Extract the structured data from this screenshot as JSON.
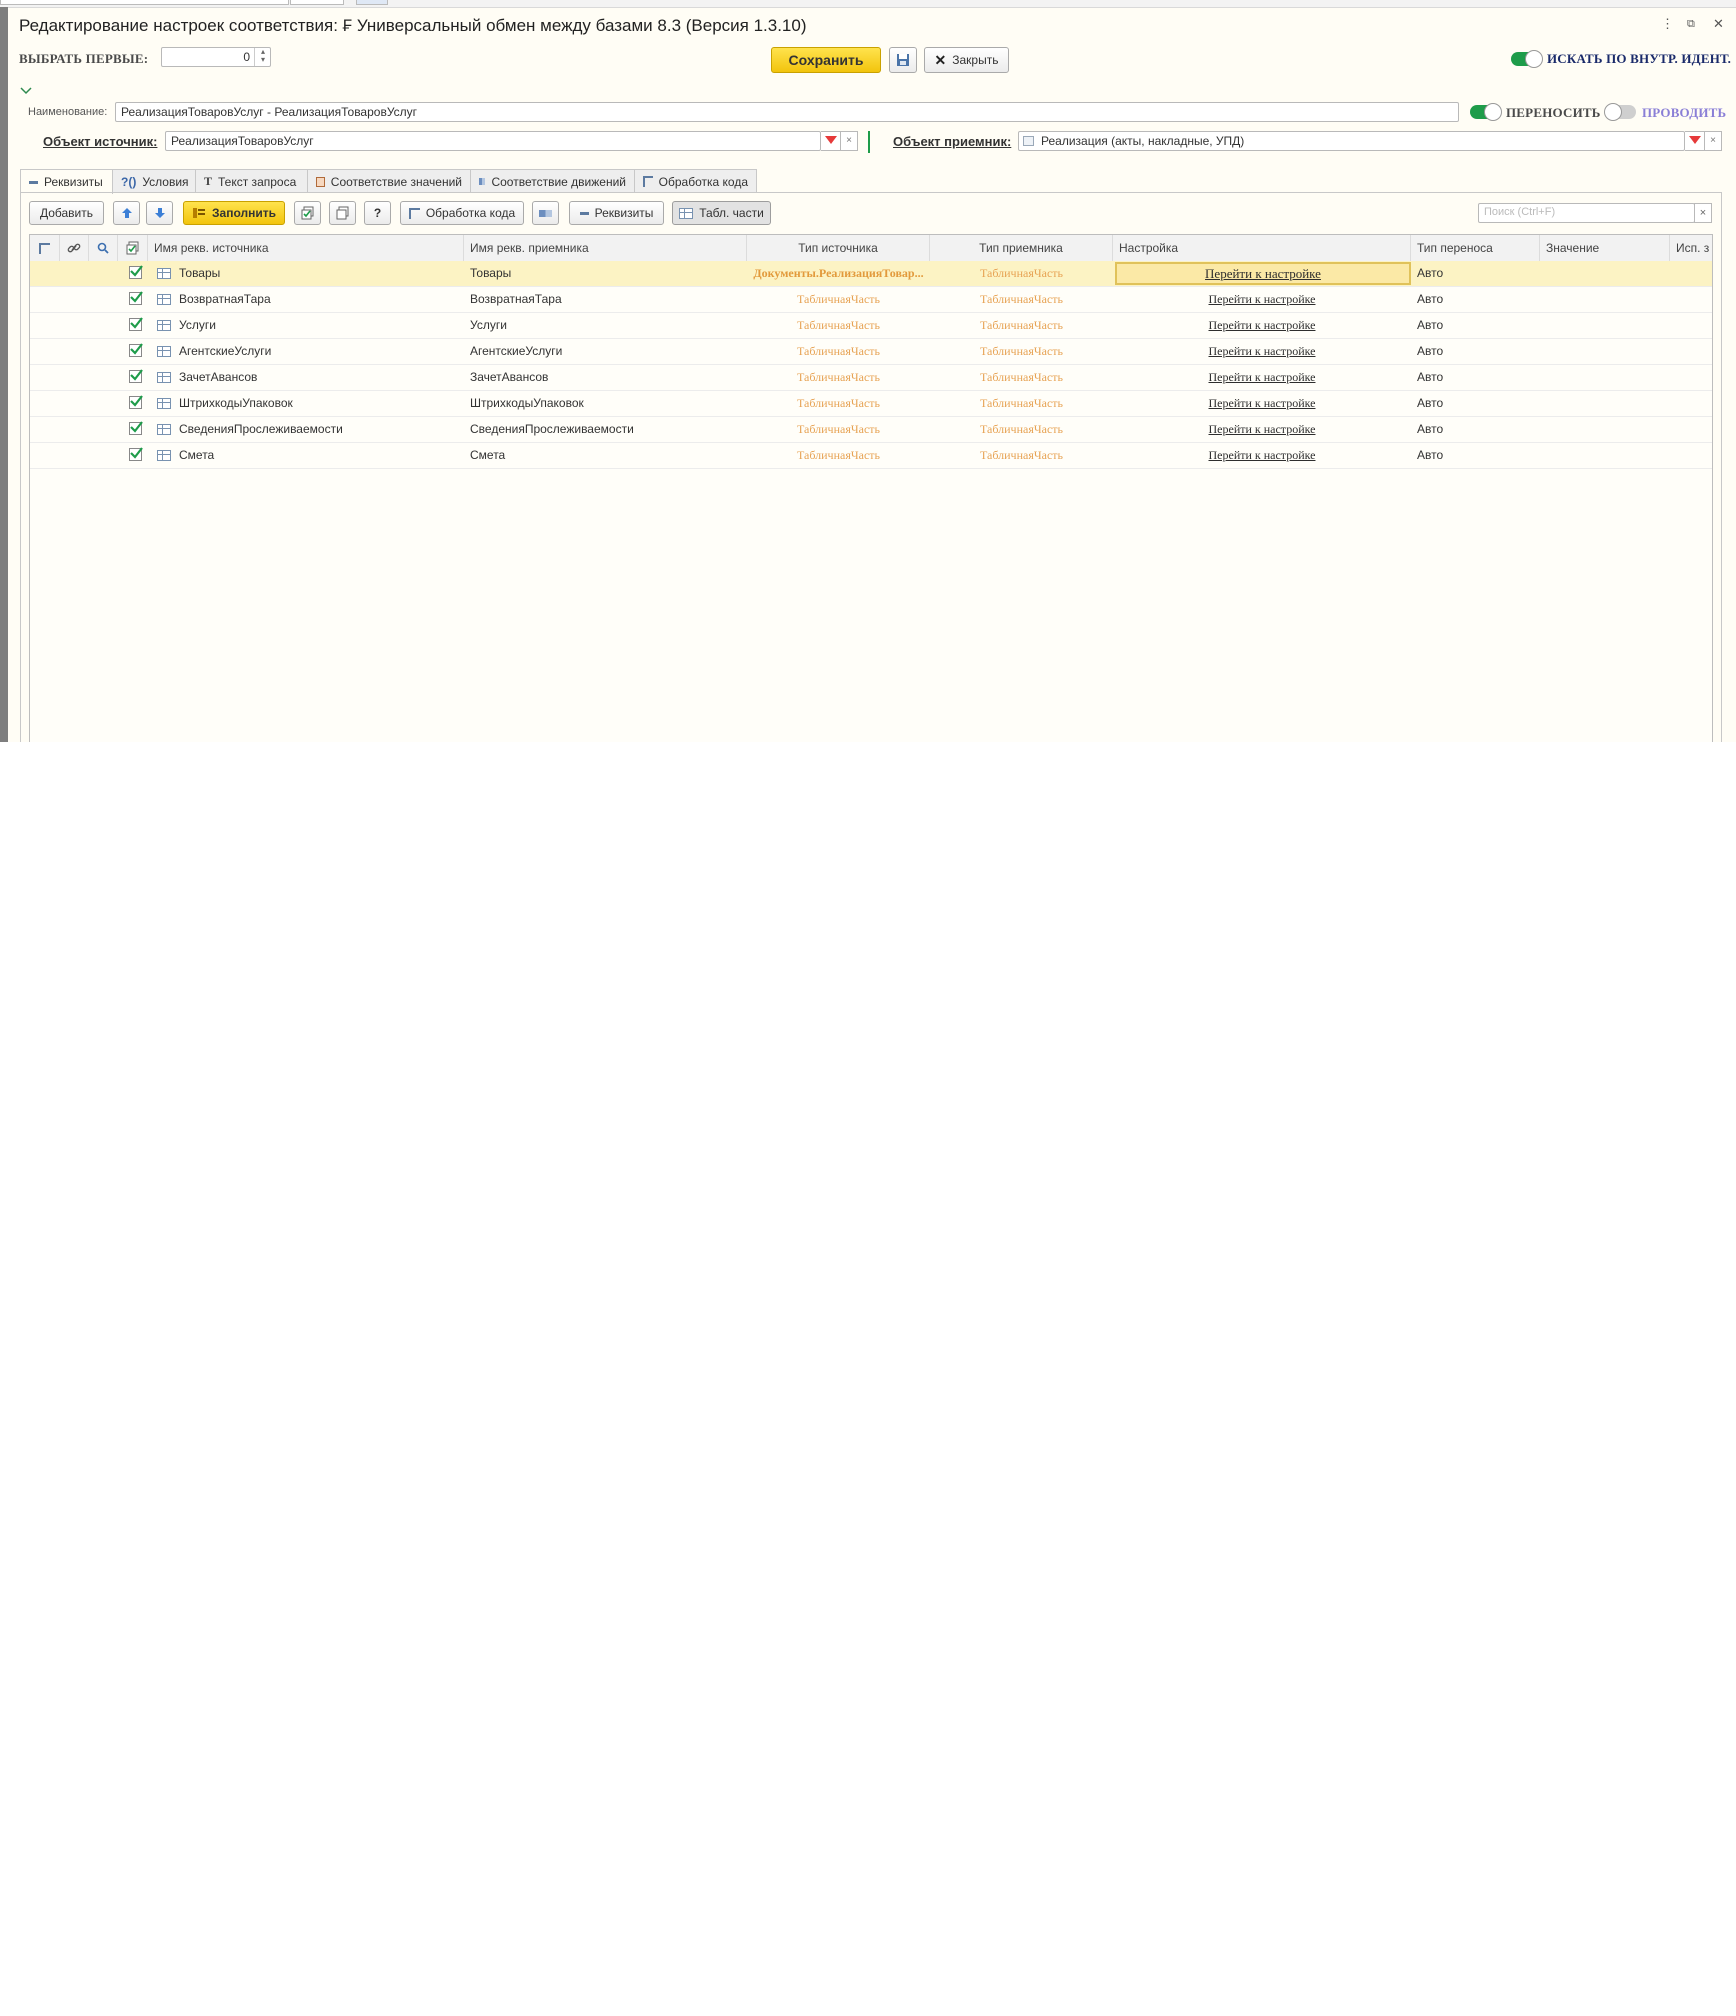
{
  "window": {
    "title": "Редактирование настроек соответствия: ₣ Универсальный обмен между базами 8.3 (Версия 1.3.10)",
    "more_icon": "⋮",
    "restore_icon": "⧉",
    "close_icon": "✕"
  },
  "header": {
    "select_first_label": "ВЫБРАТЬ ПЕРВЫЕ:",
    "select_first_value": "0",
    "save_label": "Сохранить",
    "close_label": "Закрыть",
    "search_internal_label": "ИСКАТЬ ПО ВНУТР. ИДЕНТ.",
    "search_internal_on": true
  },
  "form": {
    "name_label": "Наименование:",
    "name_value": "РеализацияТоваровУслуг - РеализацияТоваровУслуг",
    "transfer_label": "ПЕРЕНОСИТЬ",
    "transfer_on": true,
    "post_label": "ПРОВОДИТЬ",
    "post_on": false,
    "source_label": "Объект источник:",
    "source_value": "РеализацияТоваровУслуг",
    "target_label": "Объект приемник:",
    "target_value": "Реализация (акты, накладные, УПД)"
  },
  "tabs": [
    {
      "label": "Реквизиты",
      "icon": "minus-icon",
      "active": true
    },
    {
      "label": "Условия",
      "icon": "?()",
      "active": false
    },
    {
      "label": "Текст запроса",
      "icon": "T",
      "active": false
    },
    {
      "label": "Соответствие значений",
      "icon": "mapping-icon",
      "active": false
    },
    {
      "label": "Соответствие движений",
      "icon": "movements-icon",
      "active": false
    },
    {
      "label": "Обработка кода",
      "icon": "code-icon",
      "active": false
    }
  ],
  "toolbar": {
    "add_label": "Добавить",
    "fill_label": "Заполнить",
    "help_label": "?",
    "code_label": "Обработка кода",
    "attributes_label": "Реквизиты",
    "tab_parts_label": "Табл. части",
    "search_placeholder": "Поиск (Ctrl+F)",
    "search_clear": "×"
  },
  "table": {
    "columns": [
      "Имя рекв. источника",
      "Имя рекв. приемника",
      "Тип источника",
      "Тип приемника",
      "Настройка",
      "Тип переноса",
      "Значение",
      "Исп. з"
    ],
    "rows": [
      {
        "checked": true,
        "source": "Товары",
        "target": "Товары",
        "source_type": "Документы.РеализацияТовар...",
        "target_type": "ТабличнаяЧасть",
        "setting": "Перейти к настройке",
        "transfer_type": "Авто",
        "value": "",
        "selected": true
      },
      {
        "checked": true,
        "source": "ВозвратнаяТара",
        "target": "ВозвратнаяТара",
        "source_type": "ТабличнаяЧасть",
        "target_type": "ТабличнаяЧасть",
        "setting": "Перейти к настройке",
        "transfer_type": "Авто",
        "value": "",
        "selected": false
      },
      {
        "checked": true,
        "source": "Услуги",
        "target": "Услуги",
        "source_type": "ТабличнаяЧасть",
        "target_type": "ТабличнаяЧасть",
        "setting": "Перейти к настройке",
        "transfer_type": "Авто",
        "value": "",
        "selected": false
      },
      {
        "checked": true,
        "source": "АгентскиеУслуги",
        "target": "АгентскиеУслуги",
        "source_type": "ТабличнаяЧасть",
        "target_type": "ТабличнаяЧасть",
        "setting": "Перейти к настройке",
        "transfer_type": "Авто",
        "value": "",
        "selected": false
      },
      {
        "checked": true,
        "source": "ЗачетАвансов",
        "target": "ЗачетАвансов",
        "source_type": "ТабличнаяЧасть",
        "target_type": "ТабличнаяЧасть",
        "setting": "Перейти к настройке",
        "transfer_type": "Авто",
        "value": "",
        "selected": false
      },
      {
        "checked": true,
        "source": "ШтрихкодыУпаковок",
        "target": "ШтрихкодыУпаковок",
        "source_type": "ТабличнаяЧасть",
        "target_type": "ТабличнаяЧасть",
        "setting": "Перейти к настройке",
        "transfer_type": "Авто",
        "value": "",
        "selected": false
      },
      {
        "checked": true,
        "source": "СведенияПрослеживаемости",
        "target": "СведенияПрослеживаемости",
        "source_type": "ТабличнаяЧасть",
        "target_type": "ТабличнаяЧасть",
        "setting": "Перейти к настройке",
        "transfer_type": "Авто",
        "value": "",
        "selected": false
      },
      {
        "checked": true,
        "source": "Смета",
        "target": "Смета",
        "source_type": "ТабличнаяЧасть",
        "target_type": "ТабличнаяЧасть",
        "setting": "Перейти к настройке",
        "transfer_type": "Авто",
        "value": "",
        "selected": false
      }
    ]
  },
  "colors": {
    "accent_yellow": "#f5cd1a",
    "toggle_green": "#1e9c4a",
    "type_orange": "#e7a354",
    "selected_row": "#fcf3c4",
    "post_label_purple": "#8a7fd6"
  }
}
